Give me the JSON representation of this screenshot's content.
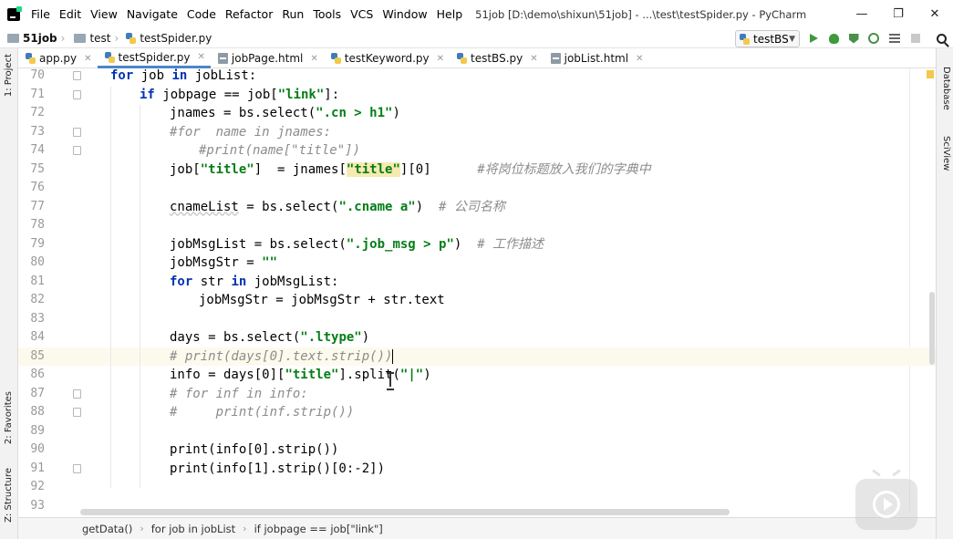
{
  "menubar": {
    "items": [
      "File",
      "Edit",
      "View",
      "Navigate",
      "Code",
      "Refactor",
      "Run",
      "Tools",
      "VCS",
      "Window",
      "Help"
    ],
    "window_title": "51job [D:\\demo\\shixun\\51job] - ...\\test\\testSpider.py - PyCharm"
  },
  "navbar": {
    "crumbs": [
      "51job",
      "test",
      "testSpider.py"
    ],
    "run_config": "testBS"
  },
  "side_tabs": {
    "left": [
      "1: Project",
      "2: Favorites",
      "Z: Structure"
    ],
    "right": [
      "Database",
      "SciView"
    ]
  },
  "tabs": [
    {
      "label": "app.py",
      "icon": "python-file-icon"
    },
    {
      "label": "testSpider.py",
      "icon": "python-file-icon",
      "active": true
    },
    {
      "label": "jobPage.html",
      "icon": "html-file-icon"
    },
    {
      "label": "testKeyword.py",
      "icon": "python-file-icon"
    },
    {
      "label": "testBS.py",
      "icon": "python-file-icon"
    },
    {
      "label": "jobList.html",
      "icon": "html-file-icon"
    }
  ],
  "editor": {
    "current_line": 85,
    "lines": [
      {
        "n": "70",
        "text": "for job in jobList:"
      },
      {
        "n": "71",
        "text": "if jobpage == job[\"link\"]:"
      },
      {
        "n": "72",
        "text": "jnames = bs.select(\".cn > h1\")"
      },
      {
        "n": "73",
        "text": "#for  name in jnames:"
      },
      {
        "n": "74",
        "text": "#print(name[\"title\"])"
      },
      {
        "n": "75",
        "text": "job[\"title\"]  = jnames[\"title\"][0]      #将岗位标题放入我们的字典中"
      },
      {
        "n": "76",
        "text": ""
      },
      {
        "n": "77",
        "text": "cnameList = bs.select(\".cname a\")  # 公司名称"
      },
      {
        "n": "78",
        "text": ""
      },
      {
        "n": "79",
        "text": "jobMsgList = bs.select(\".job_msg > p\")  # 工作描述"
      },
      {
        "n": "80",
        "text": "jobMsgStr = \"\""
      },
      {
        "n": "81",
        "text": "for str in jobMsgList:"
      },
      {
        "n": "82",
        "text": "jobMsgStr = jobMsgStr + str.text"
      },
      {
        "n": "83",
        "text": ""
      },
      {
        "n": "84",
        "text": "days = bs.select(\".ltype\")"
      },
      {
        "n": "85",
        "text": "# print(days[0].text.strip())"
      },
      {
        "n": "86",
        "text": "info = days[0][\"title\"].split(\"|\")"
      },
      {
        "n": "87",
        "text": "# for inf in info:"
      },
      {
        "n": "88",
        "text": "#     print(inf.strip())"
      },
      {
        "n": "89",
        "text": ""
      },
      {
        "n": "90",
        "text": "print(info[0].strip())"
      },
      {
        "n": "91",
        "text": "print(info[1].strip()[0:-2])"
      },
      {
        "n": "92",
        "text": ""
      },
      {
        "n": "93",
        "text": ""
      }
    ]
  },
  "statusbar": {
    "breadcrumbs": [
      "getData()",
      "for job in jobList",
      "if jobpage == job[\"link\"]"
    ]
  }
}
